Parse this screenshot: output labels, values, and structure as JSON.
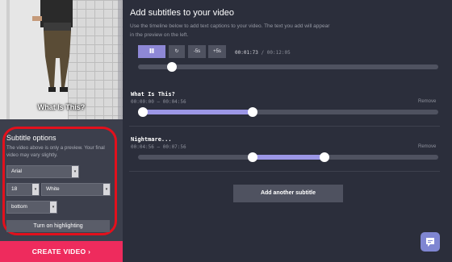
{
  "preview": {
    "caption": "What Is This?"
  },
  "subtitle_options": {
    "title": "Subtitle options",
    "description": "The video above is only a preview. Your final video may vary slightly.",
    "font": "Arial",
    "size": "18",
    "color": "White",
    "position": "bottom",
    "highlight_label": "Turn on highlighting"
  },
  "create_video_label": "CREATE VIDEO ›",
  "main": {
    "title": "Add subtitles to your video",
    "description": "Use the timeline below to add text captions to your video. The text you add will appear in the preview on the left."
  },
  "player": {
    "play_pause_icon": "pause-icon",
    "replay_icon": "replay-icon",
    "back_label": "-5s",
    "forward_label": "+5s",
    "current_time": "00:01:73",
    "separator": "/",
    "total_time": "00:12:05",
    "progress": 0.1
  },
  "subtitles": [
    {
      "title": "What Is This?",
      "time": "00:00:00 — 00:04:56",
      "remove_label": "Remove",
      "start": 0.0,
      "end": 0.378
    },
    {
      "title": "Nightmare...",
      "time": "00:04:56 — 00:07:56",
      "remove_label": "Remove",
      "start": 0.378,
      "end": 0.626
    }
  ],
  "add_subtitle_label": "Add another subtitle",
  "colors": {
    "accent": "#9c97e6",
    "create_button": "#ee2b5d",
    "highlight_ring": "#e3101c",
    "background": "#2b2e3b"
  }
}
